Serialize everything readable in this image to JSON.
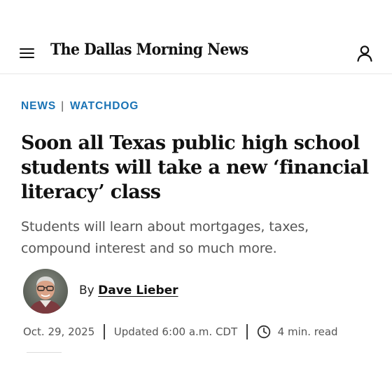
{
  "header": {
    "logo_text": "The Dallas Morning News",
    "menu_icon": "hamburger-menu-icon",
    "account_icon": "user-account-icon"
  },
  "section": {
    "primary": "NEWS",
    "secondary": "WATCHDOG",
    "color": "#1a73b5"
  },
  "article": {
    "headline": "Soon all Texas public high school students will take a new ‘financial literacy’ class",
    "dek": "Students will learn about mortgages, taxes, compound interest and so much more.",
    "byline_prefix": "By",
    "author": "Dave Lieber",
    "date": "Oct. 29, 2025",
    "updated": "Updated 6:00 a.m. CDT",
    "read_time": "4 min. read",
    "clock_icon": "clock-icon"
  }
}
